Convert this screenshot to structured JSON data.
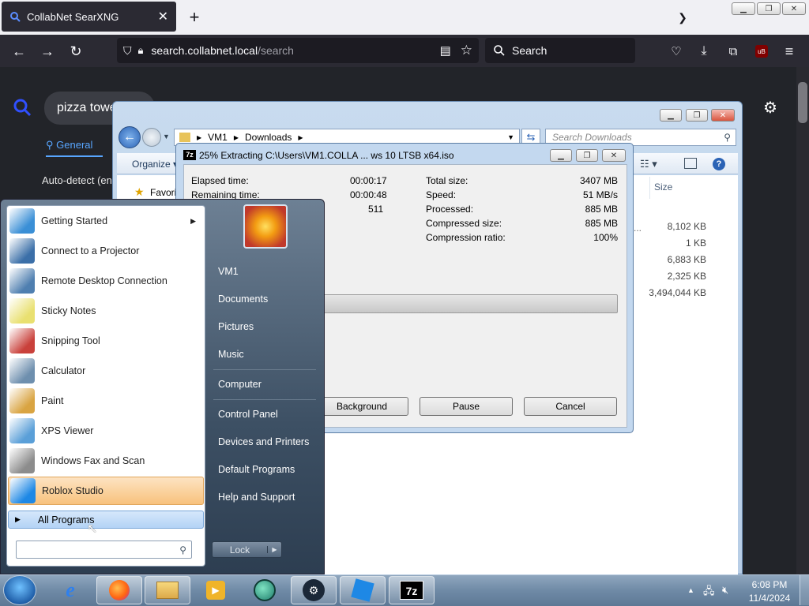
{
  "browser": {
    "tab_title": "CollabNet SearXNG",
    "new_tab": "+",
    "url_host": "search.collabnet.local",
    "url_path": "/search",
    "search_placeholder": "Search"
  },
  "searxng": {
    "query": "pizza towe",
    "tab_general": "General",
    "auto_detect": "Auto-detect (en"
  },
  "explorer": {
    "breadcrumb": [
      "VM1",
      "Downloads"
    ],
    "search_placeholder": "Search Downloads",
    "organize": "Organize",
    "favorites": "Favori",
    "size_header": "Size",
    "sizes": [
      "8,102 KB",
      "1 KB",
      "6,883 KB",
      "2,325 KB",
      "3,494,044 KB"
    ],
    "ellipsis": "..."
  },
  "zip": {
    "title": "25% Extracting C:\\Users\\VM1.COLLA ... ws 10 LTSB x64.iso",
    "elapsed_label": "Elapsed time:",
    "elapsed": "00:00:17",
    "remaining_label": "Remaining time:",
    "remaining": "00:00:48",
    "files_count": "511",
    "total_label": "Total size:",
    "total": "3407 MB",
    "speed_label": "Speed:",
    "speed": "51 MB/s",
    "processed_label": "Processed:",
    "processed": "885 MB",
    "compressed_label": "Compressed size:",
    "compressed": "885 MB",
    "ratio_label": "Compression ratio:",
    "ratio": "100%",
    "progress": 0.25,
    "btn_background": "Background",
    "btn_pause": "Pause",
    "btn_cancel": "Cancel"
  },
  "start_menu": {
    "programs": [
      {
        "label": "Getting Started",
        "icon": "getting-started-icon",
        "color": "#3a8fd6",
        "arrow": true
      },
      {
        "label": "Connect to a Projector",
        "icon": "projector-icon",
        "color": "#3b6fa8"
      },
      {
        "label": "Remote Desktop Connection",
        "icon": "remote-desktop-icon",
        "color": "#4f7fb0"
      },
      {
        "label": "Sticky Notes",
        "icon": "sticky-notes-icon",
        "color": "#e9e070"
      },
      {
        "label": "Snipping Tool",
        "icon": "scissors-icon",
        "color": "#c9413b"
      },
      {
        "label": "Calculator",
        "icon": "calculator-icon",
        "color": "#6e8fae"
      },
      {
        "label": "Paint",
        "icon": "paint-icon",
        "color": "#d9a442"
      },
      {
        "label": "XPS Viewer",
        "icon": "xps-viewer-icon",
        "color": "#5a9fd8"
      },
      {
        "label": "Windows Fax and Scan",
        "icon": "fax-icon",
        "color": "#8c8c8c"
      },
      {
        "label": "Roblox Studio",
        "icon": "roblox-studio-icon",
        "color": "#1e88e5"
      }
    ],
    "all_programs": "All Programs",
    "right_links": [
      "VM1",
      "Documents",
      "Pictures",
      "Music",
      "Computer",
      "Control Panel",
      "Devices and Printers",
      "Default Programs",
      "Help and Support"
    ],
    "lock": "Lock"
  },
  "taskbar": {
    "time": "6:08 PM",
    "date": "11/4/2024"
  }
}
